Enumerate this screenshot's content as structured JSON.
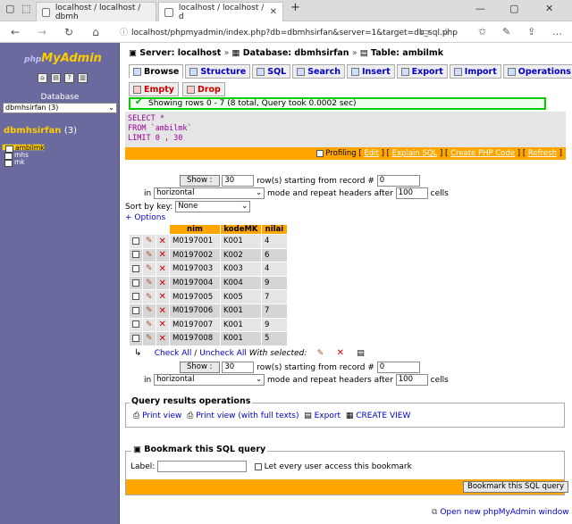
{
  "browser": {
    "tabs": [
      {
        "title": "localhost / localhost / dbmh"
      },
      {
        "title": "localhost / localhost / d"
      }
    ],
    "url": "localhost/phpmyadmin/index.php?db=dbmhsirfan&server=1&target=db_sql.php"
  },
  "sidebar": {
    "logo_php": "php",
    "logo_main": "MyAdmin",
    "database_label": "Database",
    "database_select": "dbmhsirfan (3)",
    "db_name": "dbmhsirfan",
    "db_count": "(3)",
    "tables": [
      "ambilmk",
      "mhs",
      "mk"
    ]
  },
  "breadcrumb": {
    "server": "Server: localhost",
    "database": "Database: dbmhsirfan",
    "table": "Table: ambilmk"
  },
  "tabs": [
    "Browse",
    "Structure",
    "SQL",
    "Search",
    "Insert",
    "Export",
    "Import",
    "Operations"
  ],
  "tabs2": [
    "Empty",
    "Drop"
  ],
  "message": "Showing rows 0 - 7 (8 total, Query took 0.0002 sec)",
  "sql": {
    "line1": "SELECT *",
    "line2": "FROM `ambilmk`",
    "line3": "LIMIT 0 , 30"
  },
  "sqlbar": {
    "profiling": "Profiling",
    "edit": "Edit",
    "explain": "Explain SQL",
    "php": "Create PHP Code",
    "refresh": "Refresh"
  },
  "nav": {
    "show": "Show :",
    "rows": "30",
    "rows_text": "row(s) starting from record #",
    "start": "0",
    "in": "in",
    "mode": "horizontal",
    "mode_text": "mode and repeat headers after",
    "repeat": "100",
    "cells": "cells"
  },
  "sortby": {
    "label": "Sort by key:",
    "value": "None"
  },
  "options": "+ Options",
  "columns": [
    "nim",
    "kodeMK",
    "nilai"
  ],
  "rows": [
    [
      "M0197001",
      "K001",
      "4"
    ],
    [
      "M0197002",
      "K002",
      "6"
    ],
    [
      "M0197003",
      "K003",
      "4"
    ],
    [
      "M0197004",
      "K004",
      "9"
    ],
    [
      "M0197005",
      "K005",
      "7"
    ],
    [
      "M0197006",
      "K001",
      "7"
    ],
    [
      "M0197007",
      "K001",
      "9"
    ],
    [
      "M0197008",
      "K001",
      "5"
    ]
  ],
  "checkline": {
    "checkall": "Check All",
    "sep": " / ",
    "uncheckall": "Uncheck All",
    "with_selected": "With selected:"
  },
  "query_ops": {
    "legend": "Query results operations",
    "print": "Print view",
    "print_full": "Print view (with full texts)",
    "export": "Export",
    "create_view": "CREATE VIEW"
  },
  "bookmark": {
    "legend": "Bookmark this SQL query",
    "label": "Label:",
    "everyone": "Let every user access this bookmark",
    "button": "Bookmark this SQL query"
  },
  "footer": "Open new phpMyAdmin window"
}
